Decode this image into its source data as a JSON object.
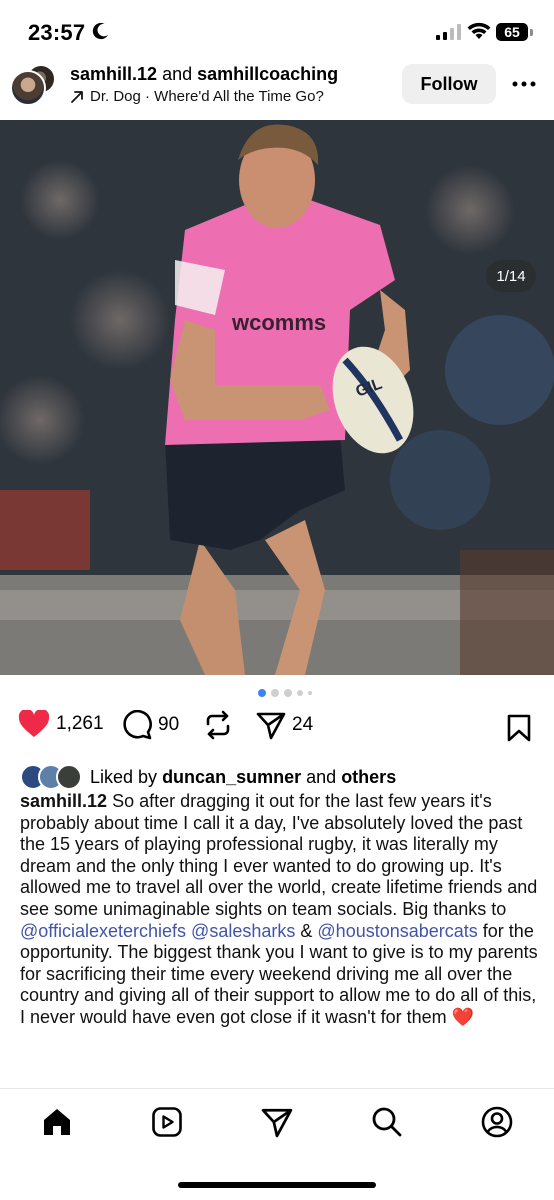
{
  "status_bar": {
    "time": "23:57",
    "battery": "65"
  },
  "header": {
    "user1": "samhill.12",
    "joiner": "and",
    "user2": "samhillcoaching",
    "music": "Dr. Dog · Where'd All the Time Go?",
    "follow_label": "Follow"
  },
  "media": {
    "counter": "1/14",
    "jersey_sponsor": "wcomms",
    "ball_text": "GIL"
  },
  "carousel": {
    "total_dots": 5,
    "active_index": 0
  },
  "actions": {
    "likes": "1,261",
    "comments": "90",
    "shares": "24",
    "accent_heart": "#ee2a48"
  },
  "liked_by": {
    "prefix": "Liked by",
    "user": "duncan_sumner",
    "joiner": "and",
    "others": "others"
  },
  "caption": {
    "author": "samhill.12",
    "text1": "So after dragging it out for the last few years it's probably about time I call it a day, I've absolutely loved the past the 15 years of playing professional rugby, it was literally my dream and the only thing I ever wanted to do growing up. It's allowed me to travel all over the world, create lifetime friends and see some unimaginable sights on team socials. Big thanks to",
    "mention1": "@officialexeterchiefs",
    "mention2": "@salesharks",
    "amp": "&",
    "mention3": "@houstonsabercats",
    "text2": "for the opportunity. The biggest thank you I want to give is to my parents for sacrificing their time every weekend driving me all over the country and giving all of their support to allow me to do all of this, I never would have even got close if it wasn't for them",
    "emoji": "❤️"
  },
  "nav": {
    "items": [
      "home-icon",
      "reels-icon",
      "send-icon",
      "search-icon",
      "profile-icon"
    ]
  }
}
